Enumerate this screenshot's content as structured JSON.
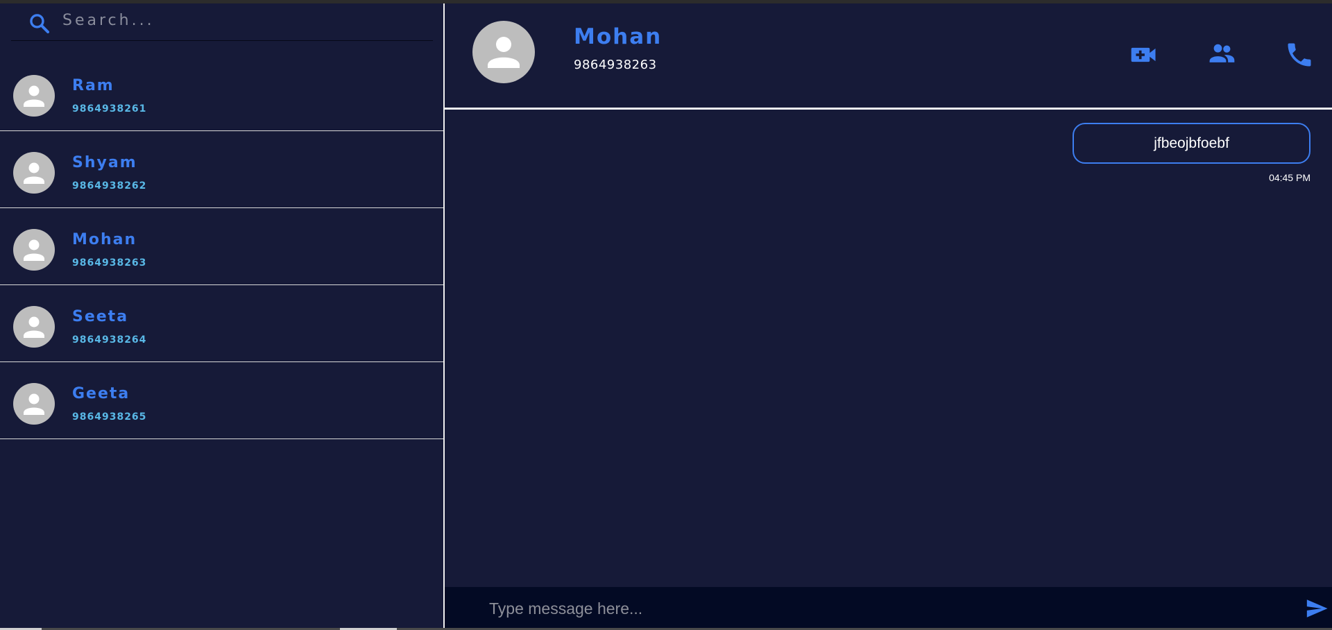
{
  "search": {
    "placeholder": "Search..."
  },
  "contacts": [
    {
      "name": "Ram",
      "phone": "9864938261"
    },
    {
      "name": "Shyam",
      "phone": "9864938262"
    },
    {
      "name": "Mohan",
      "phone": "9864938263"
    },
    {
      "name": "Seeta",
      "phone": "9864938264"
    },
    {
      "name": "Geeta",
      "phone": "9864938265"
    }
  ],
  "active_chat": {
    "name": "Mohan",
    "phone": "9864938263",
    "actions": [
      "video-call-icon",
      "group-icon",
      "phone-icon"
    ]
  },
  "messages": [
    {
      "text": "jfbeojbfoebf",
      "time": "04:45 PM",
      "direction": "outgoing"
    }
  ],
  "composer": {
    "placeholder": "Type message here..."
  },
  "colors": {
    "background": "#161a38",
    "accent": "#3d7ef0",
    "phone_text": "#59b8e6",
    "composer_bg": "#030a24",
    "avatar": "#bdbdbd"
  }
}
